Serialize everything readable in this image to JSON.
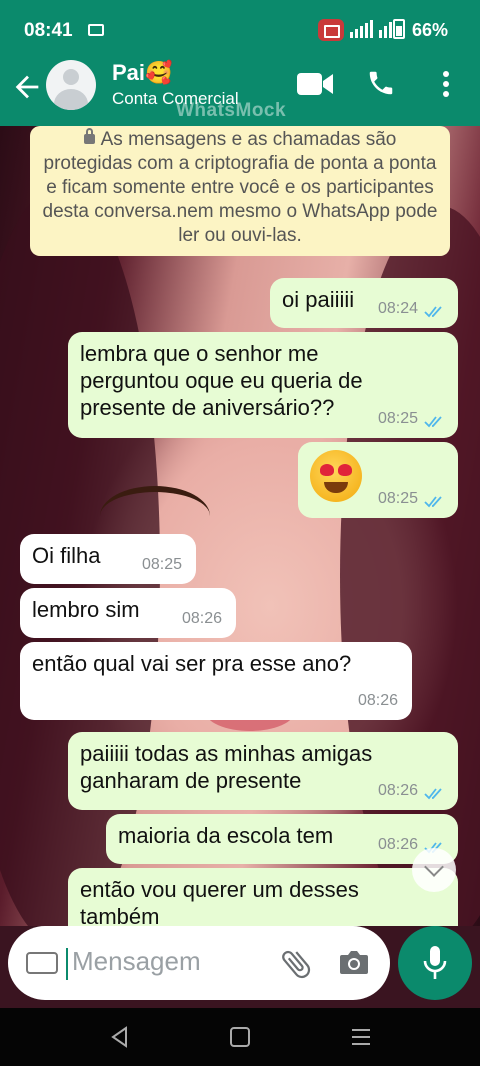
{
  "status_bar": {
    "time": "08:41",
    "battery_percent": "66%",
    "recording_indicator": "red-camera-icon",
    "colors": {
      "bar": "#0b8a6c",
      "recording": "#c93a3a"
    }
  },
  "header": {
    "contact_name": "Pai🥰",
    "contact_subtitle": "Conta Comercial",
    "watermark": "WhatsMock",
    "icons": [
      "back-arrow-icon",
      "video-call-icon",
      "voice-call-icon",
      "more-options-icon"
    ]
  },
  "chat": {
    "encryption_notice": "As mensagens e as chamadas são protegidas com a criptografia de ponta a ponta e ficam somente entre você e os participantes desta conversa.nem mesmo o WhatsApp pode ler ou ouvi-las.",
    "messages": [
      {
        "direction": "out",
        "text": "oi paiiiii",
        "time": "08:24",
        "read": true
      },
      {
        "direction": "out",
        "text": "lembra que o senhor me perguntou oque eu queria de presente de aniversário??",
        "time": "08:25",
        "read": true
      },
      {
        "direction": "out",
        "text": "😍",
        "time": "08:25",
        "read": true
      },
      {
        "direction": "in",
        "text": "Oi filha",
        "time": "08:25"
      },
      {
        "direction": "in",
        "text": "lembro sim",
        "time": "08:26"
      },
      {
        "direction": "in",
        "text": "então qual vai ser pra esse ano?",
        "time": "08:26"
      },
      {
        "direction": "out",
        "text": "paiiiii todas as minhas amigas ganharam de presente",
        "time": "08:26",
        "read": true
      },
      {
        "direction": "out",
        "text": "maioria da escola tem",
        "time": "08:26",
        "read": true
      },
      {
        "direction": "out",
        "text": "então vou querer um desses também",
        "time": "",
        "read": true
      }
    ],
    "colors": {
      "outgoing": "#e7fcd4",
      "incoming": "#ffffff",
      "notice": "#fcf4c4",
      "read_ticks": "#4fb6ec"
    }
  },
  "input": {
    "placeholder": "Mensagem",
    "icons": [
      "keyboard-icon",
      "attach-icon",
      "camera-icon",
      "mic-icon"
    ]
  },
  "navbar": {
    "icons": [
      "nav-back-icon",
      "nav-home-icon",
      "nav-recents-icon"
    ]
  }
}
